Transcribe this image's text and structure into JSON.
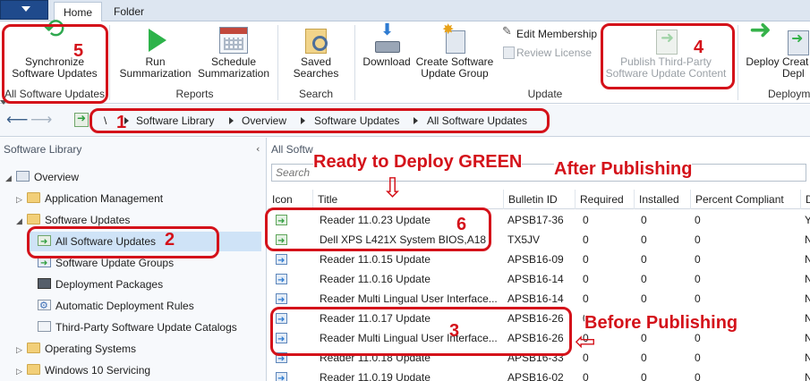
{
  "tabs": {
    "home": "Home",
    "folder": "Folder"
  },
  "ribbon": {
    "sync": "Synchronize\nSoftware Updates",
    "run": "Run\nSummarization",
    "schedule": "Schedule\nSummarization",
    "saved": "Saved\nSearches",
    "download": "Download",
    "create_group": "Create Software\nUpdate Group",
    "edit_membership": "Edit Membership",
    "review_license": "Review License",
    "publish": "Publish Third-Party\nSoftware Update Content",
    "deploy": "Deploy",
    "create_deploy": "Creat\nDepl",
    "groups": {
      "all_updates": "All Software Updates",
      "reports": "Reports",
      "search": "Search",
      "update": "Update",
      "deployment": "Deploym"
    }
  },
  "address": {
    "root": "\\",
    "crumbs": [
      "Software Library",
      "Overview",
      "Software Updates",
      "All Software Updates"
    ]
  },
  "tree": {
    "header": "Software Library",
    "items": [
      {
        "label": "Overview"
      },
      {
        "label": "Application Management"
      },
      {
        "label": "Software Updates"
      },
      {
        "label": "All Software Updates"
      },
      {
        "label": "Software Update Groups"
      },
      {
        "label": "Deployment Packages"
      },
      {
        "label": "Automatic Deployment Rules"
      },
      {
        "label": "Third-Party Software Update Catalogs"
      },
      {
        "label": "Operating Systems"
      },
      {
        "label": "Windows 10 Servicing"
      }
    ]
  },
  "list": {
    "title": "All Softw",
    "search_placeholder": "Search",
    "columns": [
      "Icon",
      "Title",
      "Bulletin ID",
      "Required",
      "Installed",
      "Percent Compliant",
      "D"
    ],
    "rows": [
      {
        "title": "Reader 11.0.23 Update",
        "bulletin": "APSB17-36",
        "required": "0",
        "installed": "0",
        "compliant": "0",
        "d": "Y",
        "status": "green"
      },
      {
        "title": "Dell XPS L421X System BIOS,A18",
        "bulletin": "TX5JV",
        "required": "0",
        "installed": "0",
        "compliant": "0",
        "d": "N",
        "status": "green"
      },
      {
        "title": "Reader 11.0.15 Update",
        "bulletin": "APSB16-09",
        "required": "0",
        "installed": "0",
        "compliant": "0",
        "d": "N",
        "status": "blue"
      },
      {
        "title": "Reader 11.0.16 Update",
        "bulletin": "APSB16-14",
        "required": "0",
        "installed": "0",
        "compliant": "0",
        "d": "N",
        "status": "blue"
      },
      {
        "title": "Reader Multi Lingual User Interface...",
        "bulletin": "APSB16-14",
        "required": "0",
        "installed": "0",
        "compliant": "0",
        "d": "N",
        "status": "blue"
      },
      {
        "title": "Reader 11.0.17 Update",
        "bulletin": "APSB16-26",
        "required": "0",
        "installed": "0",
        "compliant": "0",
        "d": "N",
        "status": "blue"
      },
      {
        "title": "Reader Multi Lingual User Interface...",
        "bulletin": "APSB16-26",
        "required": "0",
        "installed": "0",
        "compliant": "0",
        "d": "N",
        "status": "blue"
      },
      {
        "title": "Reader 11.0.18 Update",
        "bulletin": "APSB16-33",
        "required": "0",
        "installed": "0",
        "compliant": "0",
        "d": "N",
        "status": "blue"
      },
      {
        "title": "Reader 11.0.19 Update",
        "bulletin": "APSB16-02",
        "required": "0",
        "installed": "0",
        "compliant": "0",
        "d": "N",
        "status": "blue"
      }
    ]
  },
  "annotations": {
    "n1": "1",
    "n2": "2",
    "n3": "3",
    "n4": "4",
    "n5": "5",
    "n6": "6",
    "ready": "Ready to Deploy GREEN",
    "after": "After Publishing",
    "before": "Before Publishing",
    "color": "#d4121a"
  },
  "colors": {
    "accent": "#1f4a8c",
    "green_icon": "#2f9e3f",
    "blue_icon": "#2f7bd0",
    "selection": "#cfe3f7"
  }
}
